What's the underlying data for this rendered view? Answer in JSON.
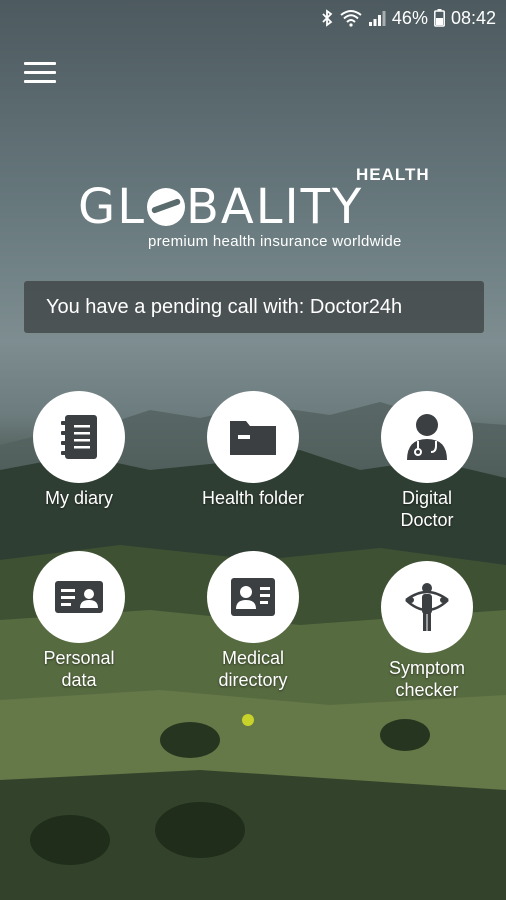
{
  "status_bar": {
    "battery_percent": "46%",
    "time": "08:42",
    "icons": [
      "bluetooth-icon",
      "wifi-icon",
      "signal-icon",
      "battery-icon"
    ]
  },
  "header": {
    "menu_icon": "hamburger-menu-icon"
  },
  "logo": {
    "health": "HEALTH",
    "text_before_o": "GL",
    "text_after_o": "BALITY",
    "tagline": "premium health insurance worldwide"
  },
  "notice": {
    "text": "You have a pending call with: Doctor24h"
  },
  "tiles": [
    {
      "icon": "diary-icon",
      "line1": "My diary",
      "line2": ""
    },
    {
      "icon": "folder-icon",
      "line1": "Health folder",
      "line2": ""
    },
    {
      "icon": "doctor-icon",
      "line1": "Digital",
      "line2": "Doctor"
    },
    {
      "icon": "id-card-icon",
      "line1": "Personal",
      "line2": "data"
    },
    {
      "icon": "medical-directory-icon",
      "line1": "Medical",
      "line2": "directory"
    },
    {
      "icon": "symptom-checker-icon",
      "line1": "Symptom",
      "line2": "checker"
    }
  ],
  "pager": {
    "active_color": "#c7d32a"
  }
}
